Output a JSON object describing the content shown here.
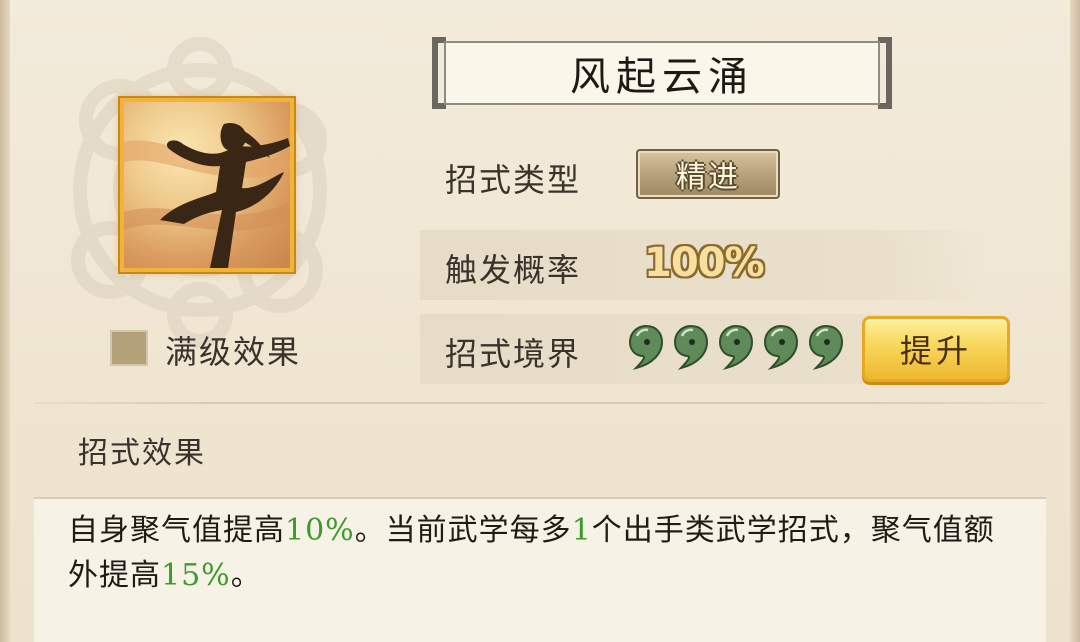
{
  "skill": {
    "name": "风起云涌",
    "icon": "dancer-silhouette-icon",
    "max_level_label": "满级效果"
  },
  "info": {
    "type_label": "招式类型",
    "type_value": "精进",
    "rate_label": "触发概率",
    "rate_value": "100%",
    "realm_label": "招式境界",
    "realm_level": 5,
    "realm_max": 5,
    "realm_icon": "jade-comma-icon",
    "upgrade_label": "提升"
  },
  "effect": {
    "heading": "招式效果",
    "parts": [
      "自身聚气值提高",
      "10%",
      "。当前武学每多",
      "1",
      "个出手类武学招式，聚气值额外提高",
      "15%",
      "。"
    ]
  },
  "colors": {
    "highlight": "#3f9a2c",
    "icon_border": "#f2b33a",
    "button_gold": "#f7d65a"
  }
}
